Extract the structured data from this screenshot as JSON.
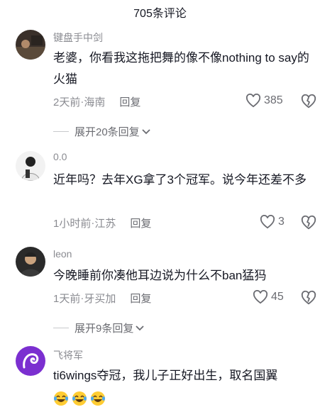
{
  "header": {
    "title": "705条评论"
  },
  "comments": [
    {
      "username": "键盘手中剑",
      "content": "老婆，你看我这拖把舞的像不像nothing to say的火猫",
      "time": "2天前",
      "location": "海南",
      "reply_label": "回复",
      "likes": "385",
      "expand_label": "展开20条回复"
    },
    {
      "username": "0.0",
      "content": "近年吗？去年XG拿了3个冠军。说今年还差不多",
      "time": "1小时前",
      "location": "江苏",
      "reply_label": "回复",
      "likes": "3"
    },
    {
      "username": "leon",
      "content": "今晚睡前你凑他耳边说为什么不ban猛犸",
      "time": "1天前",
      "location": "牙买加",
      "reply_label": "回复",
      "likes": "45",
      "expand_label": "展开9条回复"
    },
    {
      "username": "飞将军",
      "content": "ti6wings夺冠，我儿子正好出生，取名国翼",
      "emojis": [
        "laugh-cry-emoji",
        "laugh-cry-emoji",
        "laugh-cry-emoji"
      ]
    }
  ],
  "separator": " · ",
  "icons": {
    "like": "heart-outline-icon",
    "dislike": "broken-heart-icon",
    "expand": "chevron-down-icon"
  },
  "colors": {
    "meta_gray": "#8a8b91",
    "text": "#161823",
    "avatar_purple": "#7b2fd0"
  }
}
